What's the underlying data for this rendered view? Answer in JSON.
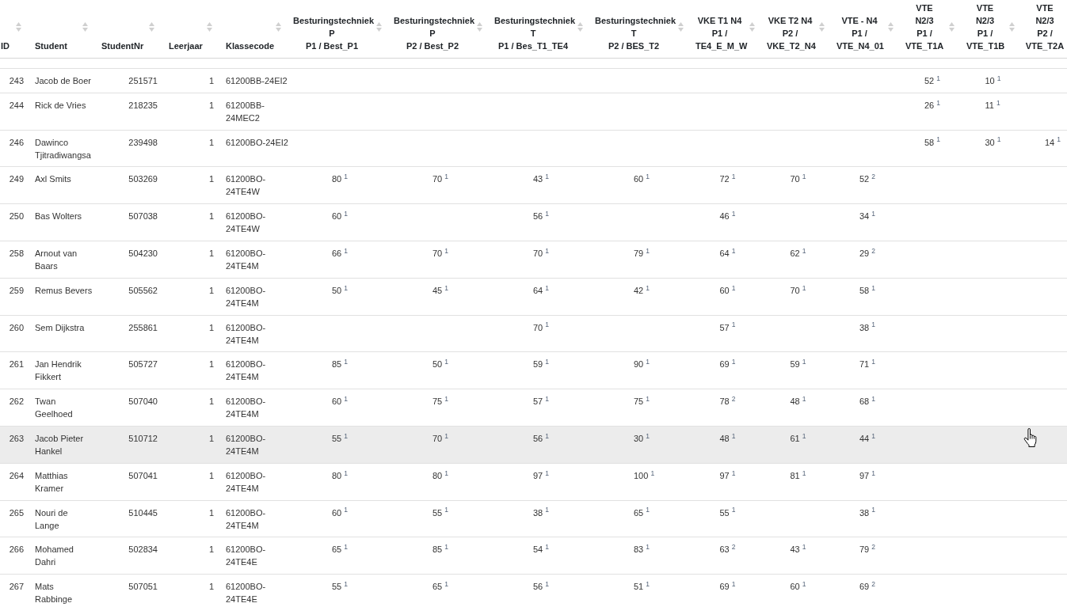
{
  "table": {
    "columns": [
      {
        "lines": [
          "ID"
        ],
        "sort_icon": true
      },
      {
        "lines": [
          "Student"
        ],
        "sort_icon": true
      },
      {
        "lines": [
          "StudentNr"
        ],
        "sort_icon": true
      },
      {
        "lines": [
          "Leerjaar"
        ],
        "sort_icon": true
      },
      {
        "lines": [
          "Klassecode"
        ],
        "sort_icon": true
      },
      {
        "lines": [
          "Besturingstechniek",
          "P",
          "P1 / Best_P1"
        ],
        "sort_icon": true
      },
      {
        "lines": [
          "Besturingstechniek",
          "P",
          "P2 / Best_P2"
        ],
        "sort_icon": true
      },
      {
        "lines": [
          "Besturingstechniek",
          "T",
          "P1 / Bes_T1_TE4"
        ],
        "sort_icon": true
      },
      {
        "lines": [
          "Besturingstechniek",
          "T",
          "P2 / BES_T2"
        ],
        "sort_icon": true
      },
      {
        "lines": [
          "VKE T1 N4",
          "P1 /",
          "TE4_E_M_W"
        ],
        "sort_icon": true
      },
      {
        "lines": [
          "VKE T2 N4",
          "P2 /",
          "VKE_T2_N4"
        ],
        "sort_icon": true
      },
      {
        "lines": [
          "VTE - N4",
          "P1 /",
          "VTE_N4_01"
        ],
        "sort_icon": true
      },
      {
        "lines": [
          "VTE",
          "N2/3",
          "P1 /",
          "VTE_T1A"
        ],
        "sort_icon": true
      },
      {
        "lines": [
          "VTE",
          "N2/3",
          "P1 /",
          "VTE_T1B"
        ],
        "sort_icon": true
      },
      {
        "lines": [
          "VTE",
          "N2/3",
          "P2 /",
          "VTE_T2A"
        ],
        "sort_icon": false
      }
    ],
    "rows": [
      {
        "id": "243",
        "student": "Jacob de Boer",
        "student_nr": "251571",
        "year": "1",
        "class_code": "61200BB-24EI2",
        "grades": {
          "vte_t1a": "52 $^{1}$",
          "vte_t1b": "10 $^{1}$"
        },
        "hovered": false
      },
      {
        "id": "244",
        "student": "Rick de Vries",
        "student_nr": "218235",
        "year": "1",
        "class_code": "61200BB-24MEC2",
        "grades": {
          "vte_t1a": "26 $^{1}$",
          "vte_t1b": "11 $^{1}$"
        },
        "hovered": false
      },
      {
        "id": "246",
        "student": "Dawinco Tjitradiwangsa",
        "student_nr": "239498",
        "year": "1",
        "class_code": "61200BO-24EI2",
        "grades": {
          "vte_t1a": "58 $^{1}$",
          "vte_t1b": "30 $^{1}$",
          "vte_t2a": "14 $^{1}$"
        },
        "hovered": false
      },
      {
        "id": "249",
        "student": "Axl Smits",
        "student_nr": "503269",
        "year": "1",
        "class_code": "61200BO-24TE4W",
        "grades": {
          "best_p1": "80 $^{1}$",
          "best_p2": "70 $^{1}$",
          "bes_t1_te4": "43 $^{1}$",
          "bes_t2": "60 $^{1}$",
          "te4_e_m_w": "72 $^{1}$",
          "vke_t2_n4": "70 $^{1}$",
          "vte_n4_01": "52 $^{2}$"
        },
        "hovered": false
      },
      {
        "id": "250",
        "student": "Bas Wolters",
        "student_nr": "507038",
        "year": "1",
        "class_code": "61200BO-24TE4W",
        "grades": {
          "best_p1": "60 $^{1}$",
          "bes_t1_te4": "56 $^{1}$",
          "te4_e_m_w": "46 $^{1}$",
          "vte_n4_01": "34 $^{1}$"
        },
        "hovered": false
      },
      {
        "id": "258",
        "student": "Arnout van Baars",
        "student_nr": "504230",
        "year": "1",
        "class_code": "61200BO-24TE4M",
        "grades": {
          "best_p1": "66 $^{1}$",
          "best_p2": "70 $^{1}$",
          "bes_t1_te4": "70 $^{1}$",
          "bes_t2": "79 $^{1}$",
          "te4_e_m_w": "64 $^{1}$",
          "vke_t2_n4": "62 $^{1}$",
          "vte_n4_01": "29 $^{2}$"
        },
        "hovered": false
      },
      {
        "id": "259",
        "student": "Remus Bevers",
        "student_nr": "505562",
        "year": "1",
        "class_code": "61200BO-24TE4M",
        "grades": {
          "best_p1": "50 $^{1}$",
          "best_p2": "45 $^{1}$",
          "bes_t1_te4": "64 $^{1}$",
          "bes_t2": "42 $^{1}$",
          "te4_e_m_w": "60 $^{1}$",
          "vke_t2_n4": "70 $^{1}$",
          "vte_n4_01": "58 $^{1}$"
        },
        "hovered": false
      },
      {
        "id": "260",
        "student": "Sem Dijkstra",
        "student_nr": "255861",
        "year": "1",
        "class_code": "61200BO-24TE4M",
        "grades": {
          "bes_t1_te4": "70 $^{1}$",
          "te4_e_m_w": "57 $^{1}$",
          "vte_n4_01": "38 $^{1}$"
        },
        "hovered": false
      },
      {
        "id": "261",
        "student": "Jan Hendrik Fikkert",
        "student_nr": "505727",
        "year": "1",
        "class_code": "61200BO-24TE4M",
        "grades": {
          "best_p1": "85 $^{1}$",
          "best_p2": "50 $^{1}$",
          "bes_t1_te4": "59 $^{1}$",
          "bes_t2": "90 $^{1}$",
          "te4_e_m_w": "69 $^{1}$",
          "vke_t2_n4": "59 $^{1}$",
          "vte_n4_01": "71 $^{1}$"
        },
        "hovered": false
      },
      {
        "id": "262",
        "student": "Twan Geelhoed",
        "student_nr": "507040",
        "year": "1",
        "class_code": "61200BO-24TE4M",
        "grades": {
          "best_p1": "60 $^{1}$",
          "best_p2": "75 $^{1}$",
          "bes_t1_te4": "57 $^{1}$",
          "bes_t2": "75 $^{1}$",
          "te4_e_m_w": "78 $^{2}$",
          "vke_t2_n4": "48 $^{1}$",
          "vte_n4_01": "68 $^{1}$"
        },
        "hovered": false
      },
      {
        "id": "263",
        "student": "Jacob Pieter Hankel",
        "student_nr": "510712",
        "year": "1",
        "class_code": "61200BO-24TE4M",
        "grades": {
          "best_p1": "55 $^{1}$",
          "best_p2": "70 $^{1}$",
          "bes_t1_te4": "56 $^{1}$",
          "bes_t2": "30 $^{1}$",
          "te4_e_m_w": "48 $^{1}$",
          "vke_t2_n4": "61 $^{1}$",
          "vte_n4_01": "44 $^{1}$"
        },
        "hovered": true
      },
      {
        "id": "264",
        "student": "Matthias Kramer",
        "student_nr": "507041",
        "year": "1",
        "class_code": "61200BO-24TE4M",
        "grades": {
          "best_p1": "80 $^{1}$",
          "best_p2": "80 $^{1}$",
          "bes_t1_te4": "97 $^{1}$",
          "bes_t2": "100 $^{1}$",
          "te4_e_m_w": "97 $^{1}$",
          "vke_t2_n4": "81 $^{1}$",
          "vte_n4_01": "97 $^{1}$"
        },
        "hovered": false
      },
      {
        "id": "265",
        "student": "Nouri de Lange",
        "student_nr": "510445",
        "year": "1",
        "class_code": "61200BO-24TE4M",
        "grades": {
          "best_p1": "60 $^{1}$",
          "best_p2": "55 $^{1}$",
          "bes_t1_te4": "38 $^{1}$",
          "bes_t2": "65 $^{1}$",
          "te4_e_m_w": "55 $^{1}$",
          "vte_n4_01": "38 $^{1}$"
        },
        "hovered": false
      },
      {
        "id": "266",
        "student": "Mohamed Dahri",
        "student_nr": "502834",
        "year": "1",
        "class_code": "61200BO-24TE4E",
        "grades": {
          "best_p1": "65 $^{1}$",
          "best_p2": "85 $^{1}$",
          "bes_t1_te4": "54 $^{1}$",
          "bes_t2": "83 $^{1}$",
          "te4_e_m_w": "63 $^{2}$",
          "vke_t2_n4": "43 $^{1}$",
          "vte_n4_01": "79 $^{2}$"
        },
        "hovered": false
      },
      {
        "id": "267",
        "student": "Mats Rabbinge",
        "student_nr": "507051",
        "year": "1",
        "class_code": "61200BO-24TE4E",
        "grades": {
          "best_p1": "55 $^{1}$",
          "best_p2": "65 $^{1}$",
          "bes_t1_te4": "56 $^{1}$",
          "bes_t2": "51 $^{1}$",
          "te4_e_m_w": "69 $^{1}$",
          "vke_t2_n4": "60 $^{1}$",
          "vte_n4_01": "69 $^{2}$"
        },
        "hovered": false
      }
    ]
  }
}
